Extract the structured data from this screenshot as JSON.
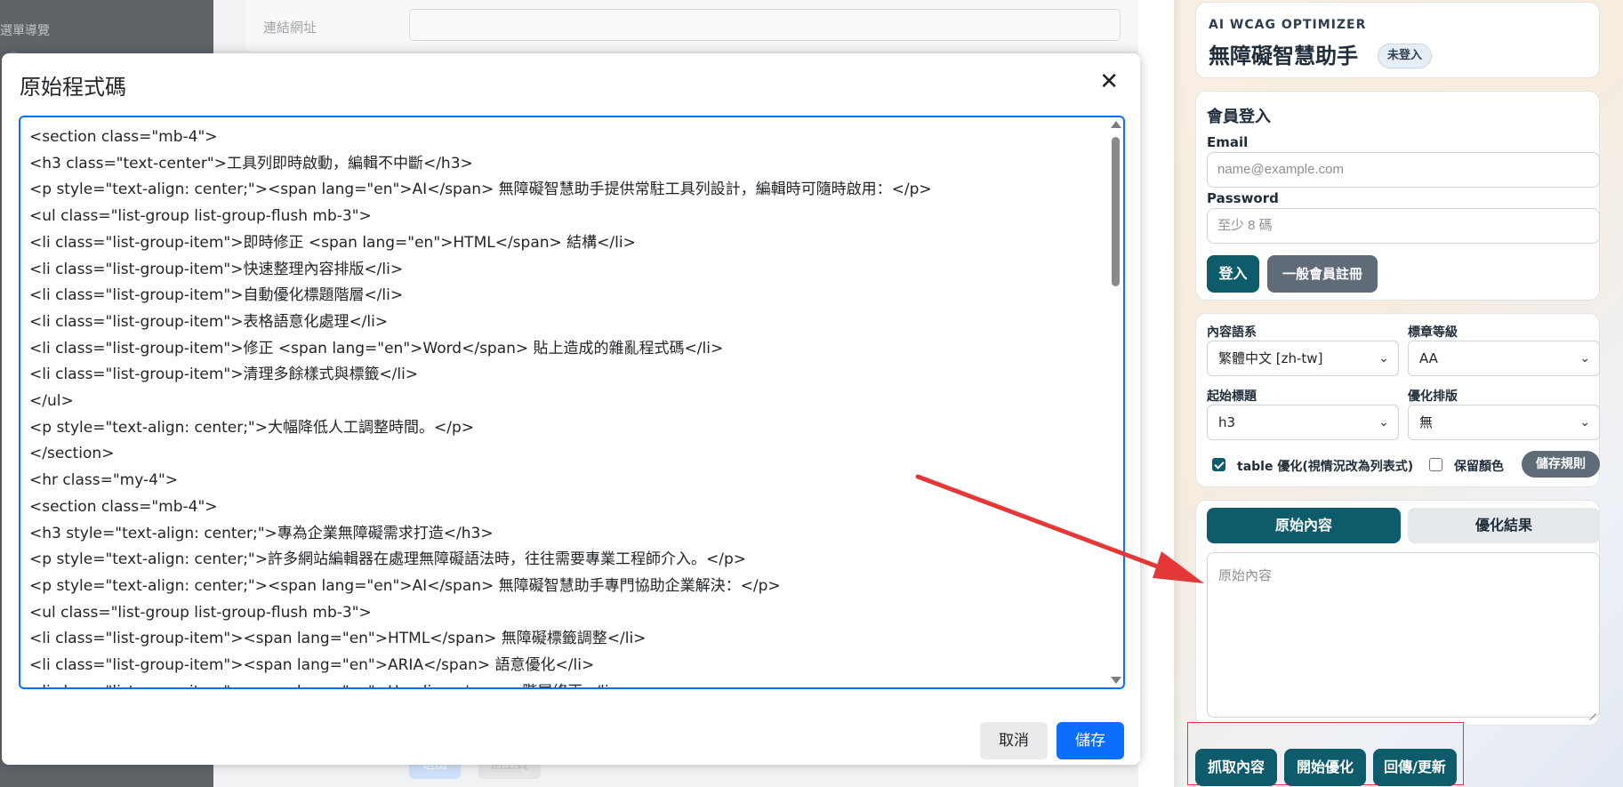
{
  "background": {
    "sidebar_label": "選單導覽",
    "field_label": "連結網址",
    "bottom_button_1": "送出",
    "bottom_button_2": "回上頁"
  },
  "modal": {
    "title": "原始程式碼",
    "close_glyph": "✕",
    "code_lines": [
      "<section class=\"mb-4\">",
      "<h3 class=\"text-center\">工具列即時啟動，編輯不中斷</h3>",
      "<p style=\"text-align: center;\"><span lang=\"en\">AI</span> 無障礙智慧助手提供常駐工具列設計，編輯時可隨時啟用：</p>",
      "<ul class=\"list-group list-group-flush mb-3\">",
      "<li class=\"list-group-item\">即時修正 <span lang=\"en\">HTML</span> 結構</li>",
      "<li class=\"list-group-item\">快速整理內容排版</li>",
      "<li class=\"list-group-item\">自動優化標題階層</li>",
      "<li class=\"list-group-item\">表格語意化處理</li>",
      "<li class=\"list-group-item\">修正 <span lang=\"en\">Word</span> 貼上造成的雜亂程式碼</li>",
      "<li class=\"list-group-item\">清理多餘樣式與標籤</li>",
      "</ul>",
      "<p style=\"text-align: center;\">大幅降低人工調整時間。</p>",
      "</section>",
      "<hr class=\"my-4\">",
      "<section class=\"mb-4\">",
      "<h3 style=\"text-align: center;\">專為企業無障礙需求打造</h3>",
      "<p style=\"text-align: center;\">許多網站編輯器在處理無障礙語法時，往往需要專業工程師介入。</p>",
      "<p style=\"text-align: center;\"><span lang=\"en\">AI</span> 無障礙智慧助手專門協助企業解決：</p>",
      "<ul class=\"list-group list-group-flush mb-3\">",
      "<li class=\"list-group-item\"><span lang=\"en\">HTML</span> 無障礙標籤調整</li>",
      "<li class=\"list-group-item\"><span lang=\"en\">ARIA</span> 語意優化</li>",
      "<li class=\"list-group-item\"><span lang=\"en\">Heading</span> 階層修正</li>"
    ],
    "cancel_label": "取消",
    "save_label": "儲存"
  },
  "panel": {
    "eyebrow": "AI WCAG OPTIMIZER",
    "app_name": "無障礙智慧助手",
    "login_status": "未登入",
    "login": {
      "title": "會員登入",
      "email_label": "Email",
      "email_placeholder": "name@example.com",
      "password_label": "Password",
      "password_placeholder": "至少 8 碼",
      "login_button": "登入",
      "register_button": "一般會員註冊"
    },
    "settings": {
      "language_label": "內容語系",
      "language_value": "繁體中文 [zh-tw]",
      "level_label": "標章等級",
      "level_value": "AA",
      "heading_label": "起始標題",
      "heading_value": "h3",
      "layout_label": "優化排版",
      "layout_value": "無",
      "table_option": "table 優化(視情況改為列表式)",
      "table_option_checked": true,
      "keep_color_option": "保留顏色",
      "keep_color_checked": false,
      "save_rules_button": "儲存規則"
    },
    "content": {
      "tab_original": "原始內容",
      "tab_optimized": "優化結果",
      "textarea_placeholder": "原始內容"
    },
    "actions": {
      "fetch_button": "抓取內容",
      "optimize_button": "開始優化",
      "return_button": "回傳/更新"
    }
  },
  "colors": {
    "primary_blue": "#0d6efd",
    "teal": "#0e5c6b",
    "gray_button": "#5f6b76",
    "annotation_red": "#e43838"
  },
  "icons": {
    "close": "close-icon",
    "select_chevron": "chevron-down-icon",
    "annotation_arrow": "arrow-annotation"
  }
}
